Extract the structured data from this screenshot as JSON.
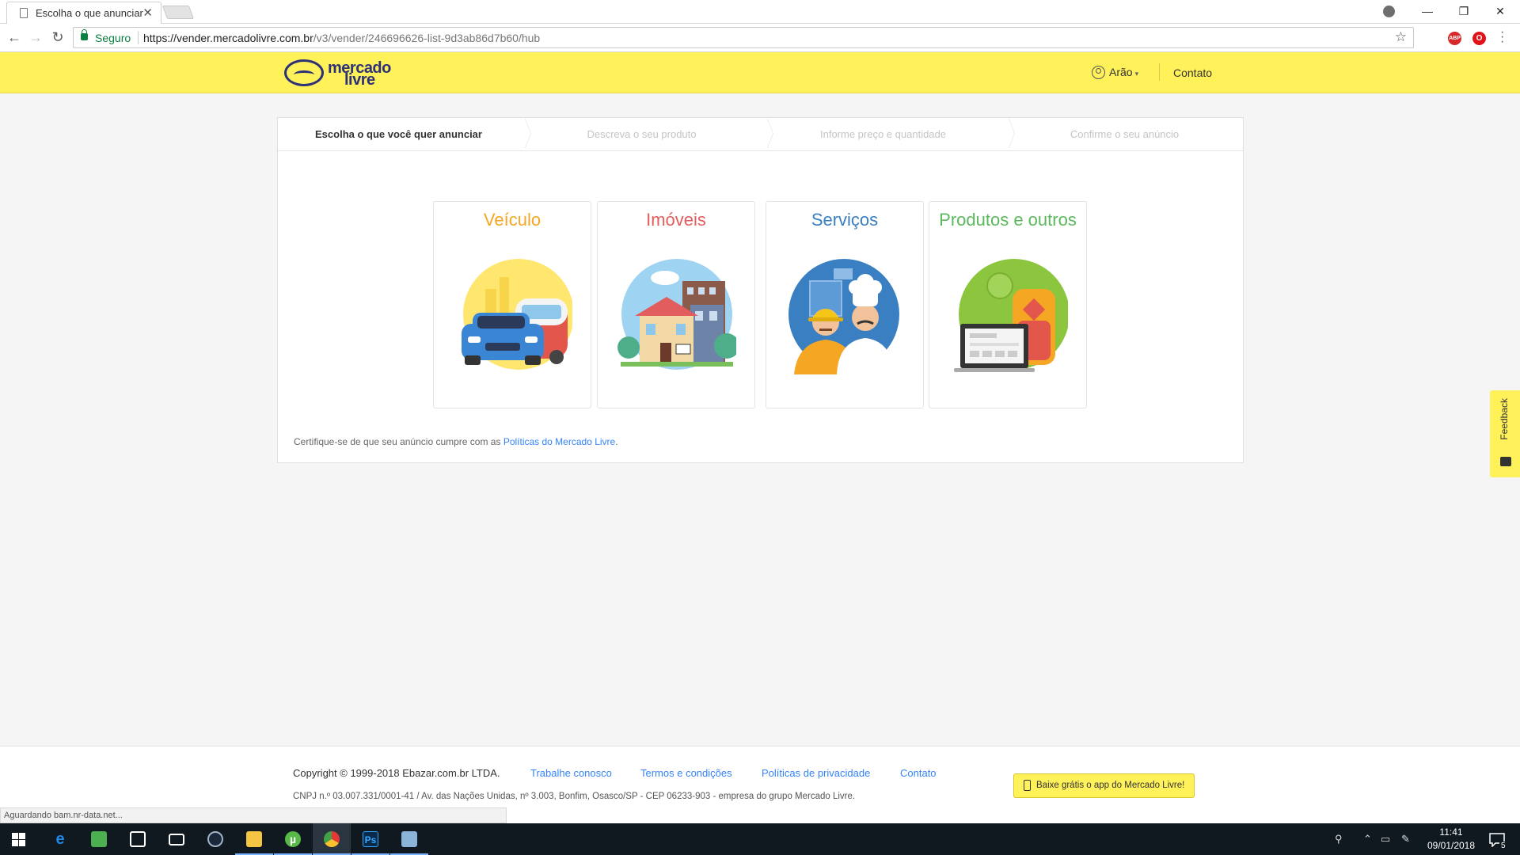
{
  "browser": {
    "tab_title": "Escolha o que anunciar",
    "tab_close": "✕",
    "secure_label": "Seguro",
    "url_host": "https://vender.mercadolivre.com.br",
    "url_path": "/v3/vender/246696626-list-9d3ab86d7b60/hub",
    "status_text": "Aguardando bam.nr-data.net...",
    "extensions": [
      "ABP",
      "O"
    ],
    "window_controls": [
      "—",
      "❐",
      "✕"
    ]
  },
  "header": {
    "brand_line1": "mercado",
    "brand_line2": "livre",
    "user_name": "Arão",
    "contact_label": "Contato"
  },
  "steps": [
    {
      "label": "Escolha o que você quer anunciar"
    },
    {
      "label": "Descreva o seu produto"
    },
    {
      "label": "Informe preço e quantidade"
    },
    {
      "label": "Confirme o seu anúncio"
    }
  ],
  "categories": [
    {
      "label": "Veículo",
      "color": "#f5a623",
      "icon": "car-icon"
    },
    {
      "label": "Imóveis",
      "color": "#e25d5d",
      "icon": "house-icon"
    },
    {
      "label": "Serviços",
      "color": "#3a7fc1",
      "icon": "worker-icon"
    },
    {
      "label": "Produtos e outros",
      "color": "#5cb85c",
      "icon": "laptop-backpack-icon"
    }
  ],
  "policy": {
    "text": "Certifique-se de que seu anúncio cumpre com as ",
    "link": "Políticas do Mercado Livre",
    "end": "."
  },
  "feedback_label": "Feedback",
  "footer": {
    "copyright": "Copyright © 1999-2018 Ebazar.com.br LTDA.",
    "links": [
      "Trabalhe conosco",
      "Termos e condições",
      "Políticas de privacidade",
      "Contato"
    ],
    "cnpj": "CNPJ n.º 03.007.331/0001-41 / Av. das Nações Unidas, nº 3.003, Bonfim, Osasco/SP - CEP 06233-903 - empresa do grupo Mercado Livre.",
    "app_button": "Baixe grátis o app do Mercado Livre!"
  },
  "taskbar": {
    "time": "11:41",
    "date": "09/01/2018",
    "notification_count": "5",
    "apps": [
      {
        "name": "edge",
        "glyph": "e",
        "color": "#1e88e5"
      },
      {
        "name": "notepad",
        "glyph": "",
        "color": "#4caf50"
      },
      {
        "name": "store",
        "glyph": "",
        "color": "#ffffff"
      },
      {
        "name": "mail",
        "glyph": "",
        "color": "#ffffff"
      },
      {
        "name": "steam",
        "glyph": "",
        "color": "#9fb5c8"
      },
      {
        "name": "explorer",
        "glyph": "",
        "color": "#f4c542"
      },
      {
        "name": "utorrent",
        "glyph": "µ",
        "color": "#56b948"
      },
      {
        "name": "chrome",
        "glyph": "",
        "color": "#e53935"
      },
      {
        "name": "photoshop",
        "glyph": "Ps",
        "color": "#0a2a4a"
      },
      {
        "name": "paint",
        "glyph": "",
        "color": "#8ab4d8"
      }
    ]
  }
}
